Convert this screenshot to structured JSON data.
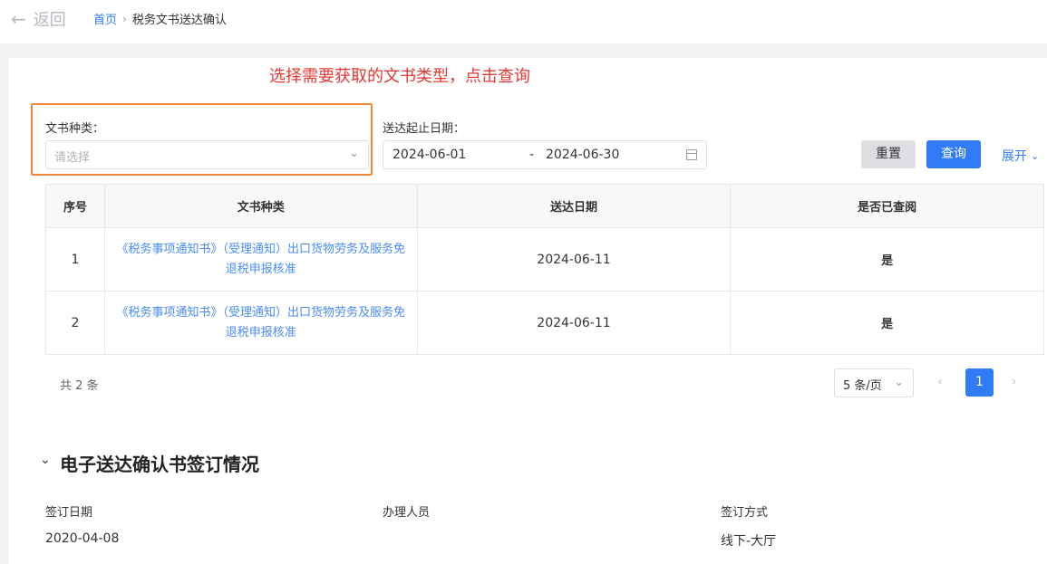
{
  "topbar": {
    "back_label": "返回",
    "breadcrumb_home": "首页",
    "breadcrumb_sep": "›",
    "breadcrumb_current": "税务文书送达确认"
  },
  "hint": "选择需要获取的文书类型，点击查询",
  "filters": {
    "doc_type_label": "文书种类：",
    "doc_type_placeholder": "请选择",
    "date_label": "送达起止日期：",
    "date_start": "2024-06-01",
    "date_sep": "-",
    "date_end": "2024-06-30",
    "reset_label": "重置",
    "query_label": "查询",
    "expand_label": "展开"
  },
  "table": {
    "headers": [
      "序号",
      "文书种类",
      "送达日期",
      "是否已查阅"
    ],
    "rows": [
      {
        "no": "1",
        "doc": "《税务事项通知书》（受理通知）出口货物劳务及服务免退税申报核准",
        "date": "2024-06-11",
        "read": "是"
      },
      {
        "no": "2",
        "doc": "《税务事项通知书》（受理通知）出口货物劳务及服务免退税申报核准",
        "date": "2024-06-11",
        "read": "是"
      }
    ]
  },
  "pagination": {
    "total": "共 2 条",
    "page_size": "5 条/页",
    "prev": "‹",
    "current": "1",
    "next": "›"
  },
  "section": {
    "title": "电子送达确认书签订情况",
    "fields": [
      {
        "label": "签订日期",
        "value": "2020-04-08"
      },
      {
        "label": "办理人员",
        "value": ""
      },
      {
        "label": "签订方式",
        "value": "线下-大厅"
      }
    ]
  },
  "colors": {
    "accent": "#2f7cf6",
    "hint_red": "#e53935",
    "highlight_orange": "#f0883a"
  }
}
